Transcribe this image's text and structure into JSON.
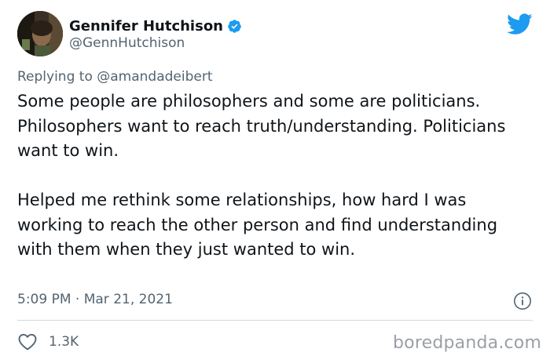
{
  "author": {
    "display_name": "Gennifer Hutchison",
    "handle": "@GennHutchison",
    "verified": true
  },
  "reply": {
    "prefix": "Replying to",
    "mention": "@amandadeibert"
  },
  "body": {
    "paragraph_1": "Some people are philosophers and some are politicians. Philosophers want to reach truth/understanding. Politicians want to win.",
    "paragraph_2": "Helped me rethink some relationships, how hard I was working to reach the other person and find understanding with them when they just wanted to win."
  },
  "meta": {
    "timestamp": "5:09 PM · Mar 21, 2021"
  },
  "actions": {
    "like_count": "1.3K"
  },
  "watermark": "boredpanda.com",
  "icons": {
    "logo": "twitter-bird-icon",
    "verified": "verified-badge-icon",
    "info": "info-icon",
    "like": "heart-icon"
  },
  "colors": {
    "brand": "#1d9bf0",
    "text": "#0f1419",
    "secondary": "#536471",
    "divider": "#cfd9de"
  }
}
